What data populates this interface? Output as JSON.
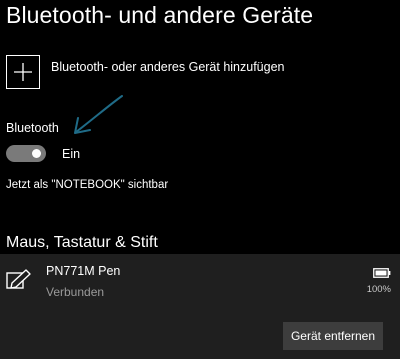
{
  "page": {
    "title": "Bluetooth- und andere Geräte"
  },
  "add_device": {
    "label": "Bluetooth- oder anderes Gerät hinzufügen",
    "icon": "plus-icon"
  },
  "bluetooth": {
    "heading": "Bluetooth",
    "toggle_on": true,
    "toggle_state_label": "Ein",
    "visibility_text": "Jetzt als \"NOTEBOOK\" sichtbar"
  },
  "annotation": {
    "icon": "hand-drawn-arrow-icon",
    "color": "#1f6b87"
  },
  "section": {
    "heading": "Maus, Tastatur & Stift"
  },
  "device": {
    "icon": "pen-icon",
    "name": "PN771M Pen",
    "status": "Verbunden",
    "battery_icon": "battery-icon",
    "battery_level": "100%",
    "remove_label": "Gerät entfernen"
  },
  "colors": {
    "background": "#000000",
    "card_background": "#1f1f1f",
    "button_background": "#3d3d3d",
    "toggle_track": "#7a7a7a",
    "secondary_text": "#9a9a9a"
  }
}
